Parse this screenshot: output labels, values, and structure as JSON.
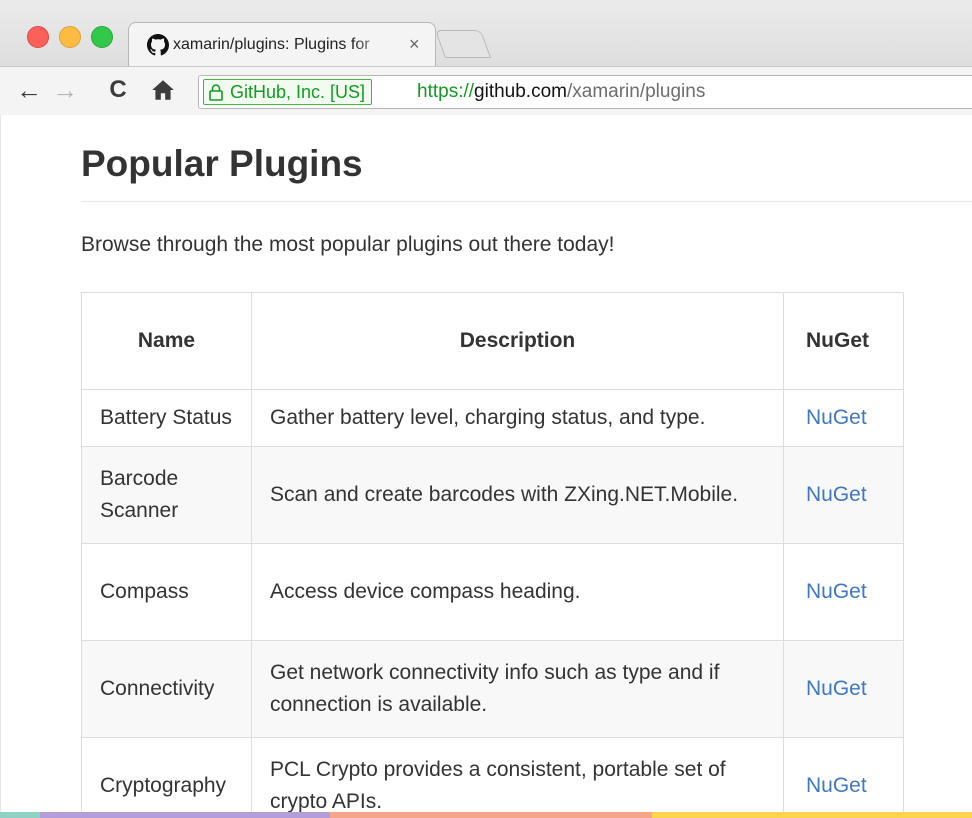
{
  "browser": {
    "tab": {
      "title": "xamarin/plugins: Plugins for",
      "close_glyph": "×",
      "favicon": "github-icon"
    },
    "nav": {
      "back": "←",
      "forward": "→",
      "reload": "C",
      "home": "⌂"
    },
    "omnibox": {
      "ev_label": "GitHub, Inc. [US]",
      "url_scheme": "https://",
      "url_host": "github.com",
      "url_path": "/xamarin/plugins"
    }
  },
  "page": {
    "title": "Popular Plugins",
    "intro": "Browse through the most popular plugins out there today!",
    "table": {
      "headers": [
        "Name",
        "Description",
        "NuGet"
      ],
      "rows": [
        {
          "name": "Battery Status",
          "description": "Gather battery level, charging status, and type.",
          "nuget": "NuGet"
        },
        {
          "name": "Barcode Scanner",
          "description": "Scan and create barcodes with ZXing.NET.Mobile.",
          "nuget": "NuGet"
        },
        {
          "name": "Compass",
          "description": "Access device compass heading.",
          "nuget": "NuGet"
        },
        {
          "name": "Connectivity",
          "description": "Get network connectivity info such as type and if connection is available.",
          "nuget": "NuGet"
        },
        {
          "name": "Cryptography",
          "description": "PCL Crypto provides a consistent, portable set of crypto APIs.",
          "nuget": "NuGet"
        }
      ]
    }
  },
  "colors": {
    "link": "#4078c0",
    "ev_green": "#149a23",
    "band": [
      "#8fd1c3",
      "#b39ddb",
      "#f4a58a",
      "#fcd34d"
    ]
  }
}
